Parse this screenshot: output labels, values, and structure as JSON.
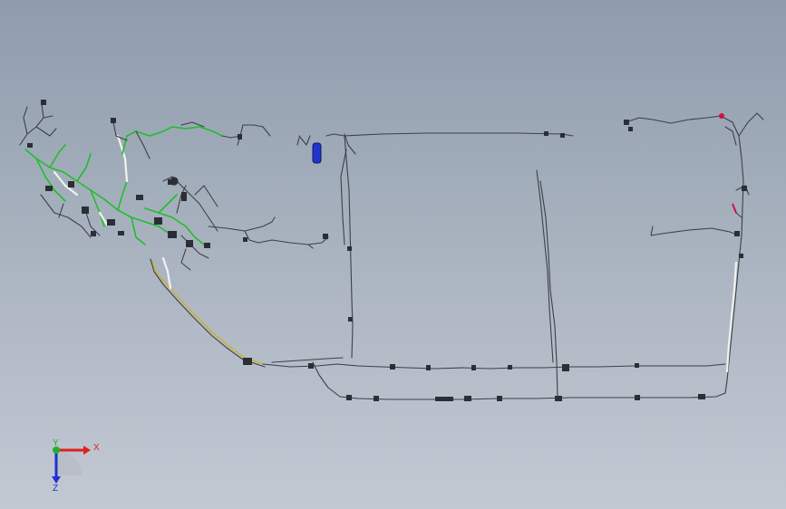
{
  "viewport": {
    "background_top": "#8e9cac",
    "background_bottom": "#c3c9d3"
  },
  "model": {
    "wire_color": "#3c4048",
    "bundle_green": "#1fbf2a",
    "sleeve_white": "#f2f2ee",
    "sleeve_yellow": "#c8b23a",
    "connector_blue": "#2233cc",
    "accent_red": "#d01040"
  },
  "triad": {
    "x_label": "X",
    "y_label": "Y",
    "z_label": "Z",
    "x_color": "#e02020",
    "y_color": "#20b030",
    "z_color": "#2030d0"
  }
}
